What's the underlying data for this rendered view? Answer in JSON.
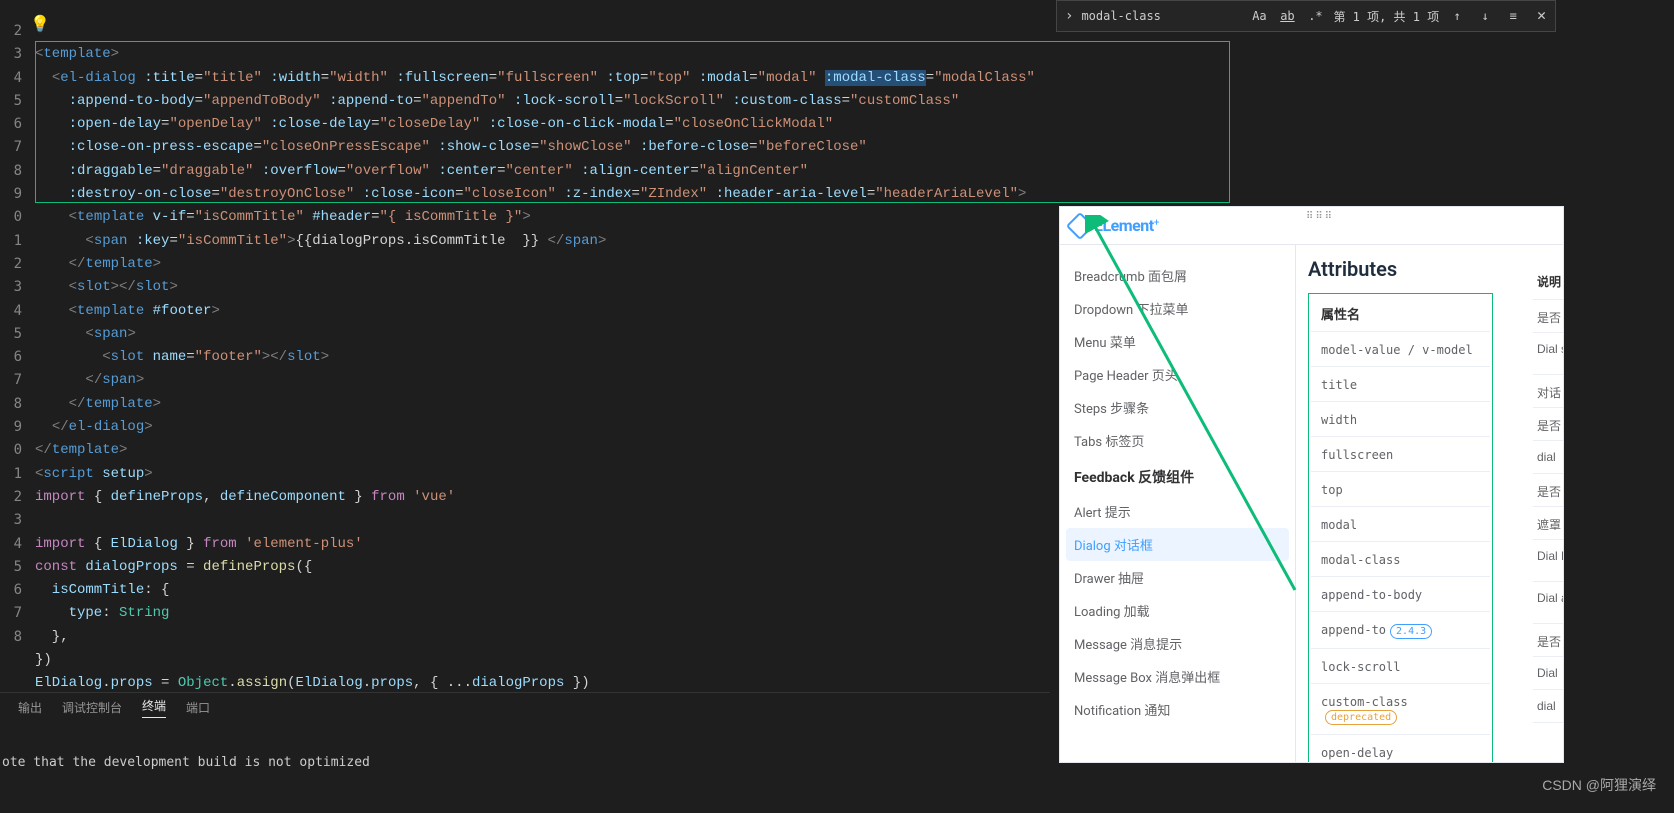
{
  "findBar": {
    "query": "modal-class",
    "matchCase": "Aa",
    "wholeWord": "ab",
    "regex": ".*",
    "status": "第 1 项, 共 1 项",
    "close": "✕"
  },
  "gutter": [
    "",
    "2",
    "3",
    "4",
    "5",
    "6",
    "7",
    "8",
    "9",
    "0",
    "1",
    "2",
    "3",
    "4",
    "5",
    "6",
    "7",
    "8",
    "9",
    "0",
    "1",
    "2",
    "3",
    "4",
    "5",
    "6",
    "7",
    "8"
  ],
  "code": {
    "l1_a": "<",
    "l1_b": "template",
    "l1_c": ">",
    "l2_a": "<",
    "l2_b": "el-dialog",
    "l2_sp": " ",
    "l2_at1": ":title",
    "l2_eq": "=",
    "l2_v1": "\"title\"",
    "l2_at2": ":width",
    "l2_v2": "\"width\"",
    "l2_at3": ":fullscreen",
    "l2_v3": "\"fullscreen\"",
    "l2_at4": ":top",
    "l2_v4": "\"top\"",
    "l2_at5": ":modal",
    "l2_v5": "\"modal\"",
    "l2_at6": ":modal-class",
    "l2_v6": "\"modalClass\"",
    "l3_at1": ":append-to-body",
    "l3_v1": "\"appendToBody\"",
    "l3_at2": ":append-to",
    "l3_v2": "\"appendTo\"",
    "l3_at3": ":lock-scroll",
    "l3_v3": "\"lockScroll\"",
    "l3_at4": ":custom-class",
    "l3_v4": "\"customClass\"",
    "l4_at1": ":open-delay",
    "l4_v1": "\"openDelay\"",
    "l4_at2": ":close-delay",
    "l4_v2": "\"closeDelay\"",
    "l4_at3": ":close-on-click-modal",
    "l4_v3": "\"closeOnClickModal\"",
    "l5_at1": ":close-on-press-escape",
    "l5_v1": "\"closeOnPressEscape\"",
    "l5_at2": ":show-close",
    "l5_v2": "\"showClose\"",
    "l5_at3": ":before-close",
    "l5_v3": "\"beforeClose\"",
    "l6_at1": ":draggable",
    "l6_v1": "\"draggable\"",
    "l6_at2": ":overflow",
    "l6_v2": "\"overflow\"",
    "l6_at3": ":center",
    "l6_v3": "\"center\"",
    "l6_at4": ":align-center",
    "l6_v4": "\"alignCenter\"",
    "l7_at1": ":destroy-on-close",
    "l7_v1": "\"destroyOnClose\"",
    "l7_at2": ":close-icon",
    "l7_v2": "\"closeIcon\"",
    "l7_at3": ":z-index",
    "l7_v3": "\"ZIndex\"",
    "l7_at4": ":header-aria-level",
    "l7_v4": "\"headerAriaLevel\"",
    "l7_end": ">",
    "l8_a": "<",
    "l8_b": "template",
    "l8_at1": "v-if",
    "l8_v1": "\"isCommTitle\"",
    "l8_at2": "#header",
    "l8_v2": "\"{ isCommTitle }\"",
    "l8_c": ">",
    "l9_a": "<",
    "l9_b": "span",
    "l9_at": ":key",
    "l9_v": "\"isCommTitle\"",
    "l9_c": ">",
    "l9_mustache": "{{dialogProps.isCommTitle  }}",
    "l9_d": " </",
    "l9_e": "span",
    "l9_f": ">",
    "l10": "</",
    "l10b": "template",
    "l10c": ">",
    "l11": "<",
    "l11b": "slot",
    "l11c": "></",
    "l11d": "slot",
    "l11e": ">",
    "l12": "<",
    "l12b": "template",
    "l12at": "#footer",
    "l12c": ">",
    "l13": "<",
    "l13b": "span",
    "l13c": ">",
    "l14": "<",
    "l14b": "slot",
    "l14at": "name",
    "l14v": "\"footer\"",
    "l14c": "></",
    "l14d": "slot",
    "l14e": ">",
    "l15": "</",
    "l15b": "span",
    "l15c": ">",
    "l16": "</",
    "l16b": "template",
    "l16c": ">",
    "l17": "</",
    "l17b": "el-dialog",
    "l17c": ">",
    "l18": "</",
    "l18b": "template",
    "l18c": ">",
    "l19": "<",
    "l19b": "script",
    "l19at": "setup",
    "l19c": ">",
    "l20a": "import",
    "l20b": " { ",
    "l20c": "defineProps",
    "l20d": ", ",
    "l20e": "defineComponent",
    "l20f": " } ",
    "l20g": "from",
    "l20h": " 'vue'",
    "l22a": "import",
    "l22b": " { ",
    "l22c": "ElDialog",
    "l22d": " } ",
    "l22e": "from",
    "l22f": " 'element-plus'",
    "l23a": "const",
    "l23b": " dialogProps ",
    "l23c": "=",
    "l23d": " defineProps",
    "l23e": "({",
    "l24a": "  isCommTitle",
    "l24b": ": {",
    "l25a": "    type",
    "l25b": ": ",
    "l25c": "String",
    "l26": "  },",
    "l27": "})",
    "l28a": "ElDialog",
    "l28b": ".",
    "l28c": "props",
    "l28d": " = ",
    "l28e": "Object",
    "l28f": ".",
    "l28g": "assign",
    "l28h": "(",
    "l28i": "ElDialog",
    "l28j": ".",
    "l28k": "props",
    "l28l": ", { ...",
    "l28m": "dialogProps",
    "l28n": " })"
  },
  "tabs": {
    "t1": "输出",
    "t2": "调试控制台",
    "t3": "终端",
    "t4": "端口"
  },
  "terminalLine": "ote that the development build is not optimized",
  "docs": {
    "logo": "ELement",
    "heading": "Attributes",
    "attrHeader": "属性名",
    "descHeader": "说明",
    "nav": [
      "Breadcrumb 面包屑",
      "Dropdown 下拉菜单",
      "Menu 菜单",
      "Page Header 页头",
      "Steps 步骤条",
      "Tabs 标签页"
    ],
    "feedbackTitle": "Feedback 反馈组件",
    "feedback": [
      "Alert 提示",
      "Dialog 对话框",
      "Drawer 抽屉",
      "Loading 加载",
      "Message 消息提示",
      "Message Box 消息弹出框",
      "Notification 通知"
    ],
    "attrs": [
      "model-value / v-model",
      "title",
      "width",
      "fullscreen",
      "top",
      "modal",
      "modal-class",
      "append-to-body",
      "append-to",
      "lock-scroll",
      "custom-class",
      "open-delay"
    ],
    "descs": [
      "是否",
      "Dial slot",
      "对话",
      "是否",
      "dial",
      "是否",
      "遮罩",
      "Dial Dial",
      "Dial ap",
      "是否",
      "Dial",
      "dial"
    ],
    "verBadge": "2.4.3",
    "depBadge": "deprecated"
  },
  "watermark": "CSDN @阿狸演绎"
}
